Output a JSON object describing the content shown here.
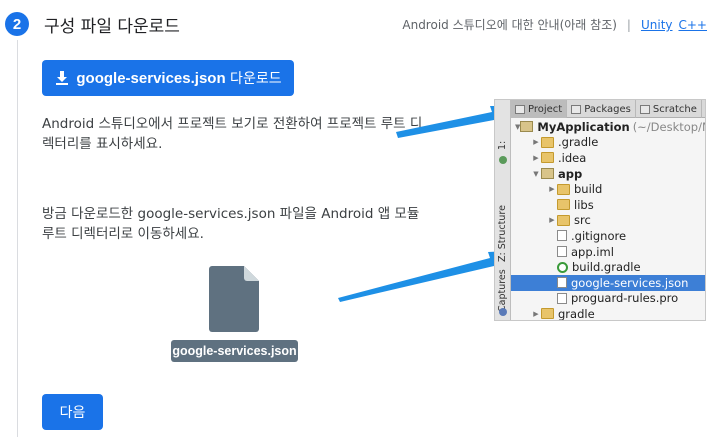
{
  "step": {
    "number": "2",
    "title": "구성 파일 다운로드"
  },
  "guide": {
    "text": "Android 스튜디오에 대한 안내(아래 참조)",
    "separator": "|",
    "links": [
      "Unity",
      "C++"
    ]
  },
  "download_button": {
    "icon": "download-icon",
    "file_label": "google-services.json",
    "suffix": " 다운로드"
  },
  "instructions": {
    "para1": "Android 스튜디오에서 프로젝트 보기로 전환하여 프로젝트 루트 디렉터리를 표시하세요.",
    "para2": "방금 다운로드한 google-services.json 파일을 Android 앱 모듈 루트 디렉터리로 이동하세요."
  },
  "file_chip": "google-services.json",
  "next_button": "다음",
  "ide": {
    "tabs": [
      "Project",
      "Packages",
      "Scratche"
    ],
    "side_labels": [
      "1: ",
      "Z: Structure",
      "Captures"
    ],
    "tree": [
      {
        "indent": 0,
        "twisty": "▼",
        "icon": "module-folder-icon",
        "name": "MyApplication",
        "detail": "(~/Desktop/My",
        "bold": true
      },
      {
        "indent": 1,
        "twisty": "▶",
        "icon": "folder-icon",
        "name": ".gradle"
      },
      {
        "indent": 1,
        "twisty": "▶",
        "icon": "folder-icon",
        "name": ".idea"
      },
      {
        "indent": 1,
        "twisty": "▼",
        "icon": "module-folder-icon",
        "name": "app",
        "bold": true
      },
      {
        "indent": 2,
        "twisty": "▶",
        "icon": "folder-icon",
        "name": "build"
      },
      {
        "indent": 2,
        "twisty": "",
        "icon": "folder-icon",
        "name": "libs"
      },
      {
        "indent": 2,
        "twisty": "▶",
        "icon": "folder-icon",
        "name": "src"
      },
      {
        "indent": 2,
        "twisty": "",
        "icon": "file-icon",
        "name": ".gitignore"
      },
      {
        "indent": 2,
        "twisty": "",
        "icon": "file-icon",
        "name": "app.iml"
      },
      {
        "indent": 2,
        "twisty": "",
        "icon": "gradle-icon",
        "name": "build.gradle"
      },
      {
        "indent": 2,
        "twisty": "",
        "icon": "file-icon",
        "name": "google-services.json",
        "selected": true
      },
      {
        "indent": 2,
        "twisty": "",
        "icon": "file-icon",
        "name": "proguard-rules.pro"
      },
      {
        "indent": 1,
        "twisty": "▶",
        "icon": "folder-icon",
        "name": "gradle"
      }
    ]
  },
  "colors": {
    "primary": "#1a73e8",
    "chip": "#5f7180",
    "arrow": "#1e90e6",
    "selection": "#3d7fd6"
  }
}
